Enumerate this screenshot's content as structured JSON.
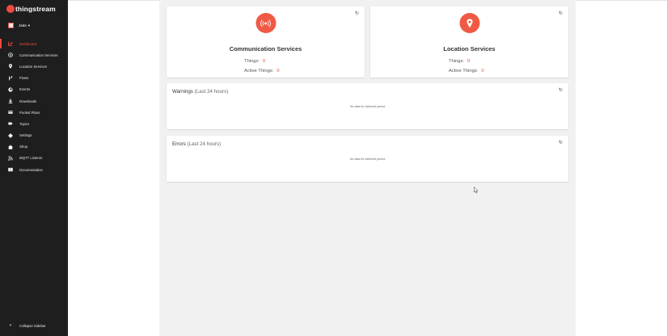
{
  "brand": {
    "logo_text": "thingstream",
    "accent": "#ee4a3f"
  },
  "user": {
    "name": "Jada",
    "caret": "⌄"
  },
  "sidebar": {
    "items": [
      {
        "label": "Dashboard",
        "icon": "chart-icon",
        "active": true
      },
      {
        "label": "Communication Services",
        "icon": "broadcast-icon"
      },
      {
        "label": "Location Services",
        "icon": "pin-icon"
      },
      {
        "label": "Flows",
        "icon": "flow-icon"
      },
      {
        "label": "Events",
        "icon": "bell-icon"
      },
      {
        "label": "Downloads",
        "icon": "download-icon"
      },
      {
        "label": "Pooled Plans",
        "icon": "card-icon"
      },
      {
        "label": "Topics",
        "icon": "tag-icon"
      },
      {
        "label": "Settings",
        "icon": "gear-icon"
      },
      {
        "label": "Shop",
        "icon": "bag-icon"
      },
      {
        "label": "MQTT Listener",
        "icon": "signal-icon"
      },
      {
        "label": "Documentation",
        "icon": "book-icon"
      }
    ],
    "collapse_label": "Collapse Sidebar"
  },
  "cards": {
    "communication": {
      "title": "Communication Services",
      "things_label": "Things:",
      "things_value": "0",
      "active_label": "Active Things:",
      "active_value": "0"
    },
    "location": {
      "title": "Location Services",
      "things_label": "Things:",
      "things_value": "0",
      "active_label": "Active Things:",
      "active_value": "0"
    }
  },
  "warnings": {
    "title": "Warnings",
    "period": "(Last 24 hours)",
    "empty": "No data for selected period"
  },
  "errors": {
    "title": "Errors",
    "period": "(Last 24 hours)",
    "empty": "No data for selected period"
  }
}
